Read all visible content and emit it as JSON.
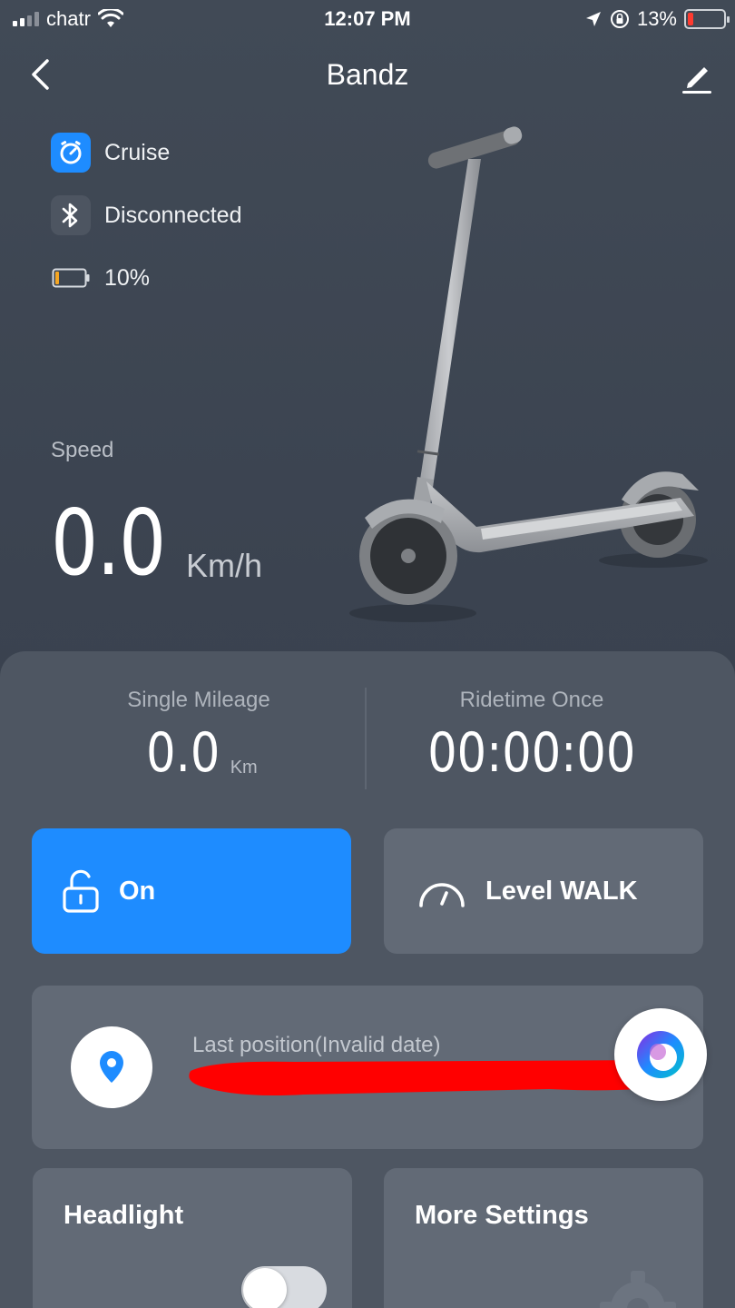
{
  "status_bar": {
    "carrier": "chatr",
    "time": "12:07 PM",
    "battery_percent": "13%",
    "icons": [
      "signal-icon",
      "wifi-icon",
      "location-arrow-icon",
      "orientation-lock-icon",
      "battery-icon"
    ]
  },
  "header": {
    "title": "Bandz",
    "back_icon": "chevron-left-icon",
    "edit_icon": "pencil-icon"
  },
  "scooter_info": [
    {
      "icon": "cruise-icon",
      "label": "Cruise"
    },
    {
      "icon": "bluetooth-icon",
      "label": "Disconnected"
    },
    {
      "icon": "battery-icon",
      "label": "10%"
    }
  ],
  "speed": {
    "label": "Speed",
    "value": "0.0",
    "unit": "Km/h"
  },
  "stats": {
    "mileage_label": "Single Mileage",
    "mileage_value": "0.0",
    "mileage_unit": "Km",
    "ridetime_label": "Ridetime Once",
    "ridetime_value": "00:00:00"
  },
  "controls": {
    "lock_label": "On",
    "level_label": "Level WALK"
  },
  "position": {
    "label": "Last position(Invalid date)"
  },
  "tiles": {
    "headlight_label": "Headlight",
    "headlight_on": false,
    "more_settings_label": "More Settings"
  },
  "colors": {
    "accent": "#1e8cff",
    "background": "#3b4350",
    "panel": "#4e5662",
    "card": "#626a76",
    "redaction": "#ff0000"
  }
}
